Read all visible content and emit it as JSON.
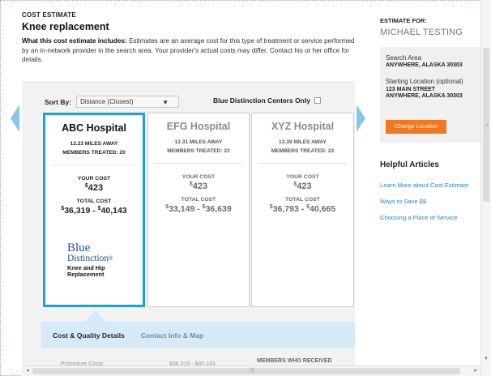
{
  "header": {
    "eyebrow": "COST ESTIMATE",
    "title": "Knee replacement",
    "desc_bold": "What this cost estimate includes:",
    "desc_text": " Estimates are an average cost for this type of treatment or service performed by an in-network provider in the search area. Your provider's actual costs may differ. Contact his or her office for details."
  },
  "sort": {
    "label": "Sort By:",
    "value": "Distance (Closest)",
    "arrow": "▼",
    "bdc_label": "Blue Distinction Centers Only"
  },
  "hospitals": [
    {
      "name": "ABC Hospital",
      "miles": "12.23 MILES AWAY",
      "treated": "MEMBERS TREATED: 20",
      "your_cost_label": "YOUR COST",
      "your_cost": "423",
      "total_cost_label": "TOTAL COST",
      "low": "36,319",
      "high": "40,143"
    },
    {
      "name": "EFG Hospital",
      "miles": "12.31 MILES AWAY",
      "treated": "MEMBERS TREATED: 22",
      "your_cost_label": "YOUR COST",
      "your_cost": "423",
      "total_cost_label": "TOTAL COST",
      "low": "33,149",
      "high": "36,639"
    },
    {
      "name": "XYZ Hospital",
      "miles": "13.39 MILES AWAY",
      "treated": "MEMBERS TREATED: 22",
      "your_cost_label": "YOUR COST",
      "your_cost": "423",
      "total_cost_label": "TOTAL COST",
      "low": "36,793",
      "high": "40,665"
    }
  ],
  "currency": "$",
  "range_sep": " - ",
  "badge": {
    "line1": "Blue",
    "line2": "Distinction",
    "mark": "®",
    "line3": "Knee and Hip",
    "line4": "Replacement"
  },
  "tabs": [
    "Cost & Quality Details",
    "Contact Info & Map"
  ],
  "detail_row": {
    "label": "Procedure Costs",
    "value": "$36,319 - $40,143",
    "members_label": "MEMBERS WHO RECEIVED"
  },
  "sidebar": {
    "estimate_for_label": "ESTIMATE FOR:",
    "name": "MICHAEL TESTING",
    "search_area_label": "Search Area",
    "search_area_value": "ANYWHERE, ALASKA 30303",
    "start_label": "Starting Location (optional)",
    "start_line1": "123 MAIN STREET",
    "start_line2": "ANYWHERE, ALASKA 30303",
    "change_button": "Change Location",
    "helpful_title": "Helpful Articles",
    "links": [
      "Learn More about Cost Estimate",
      "Ways to Save $$",
      "Choosing a Place of Service"
    ]
  },
  "colors": {
    "selected_border": "#1fa0d8",
    "nav_arrow": "#86c6e8",
    "tab_bar": "#d6ebf7",
    "change_button": "#f2771f",
    "link": "#1f88c8",
    "blue_distinction": "#1b4f9c"
  }
}
